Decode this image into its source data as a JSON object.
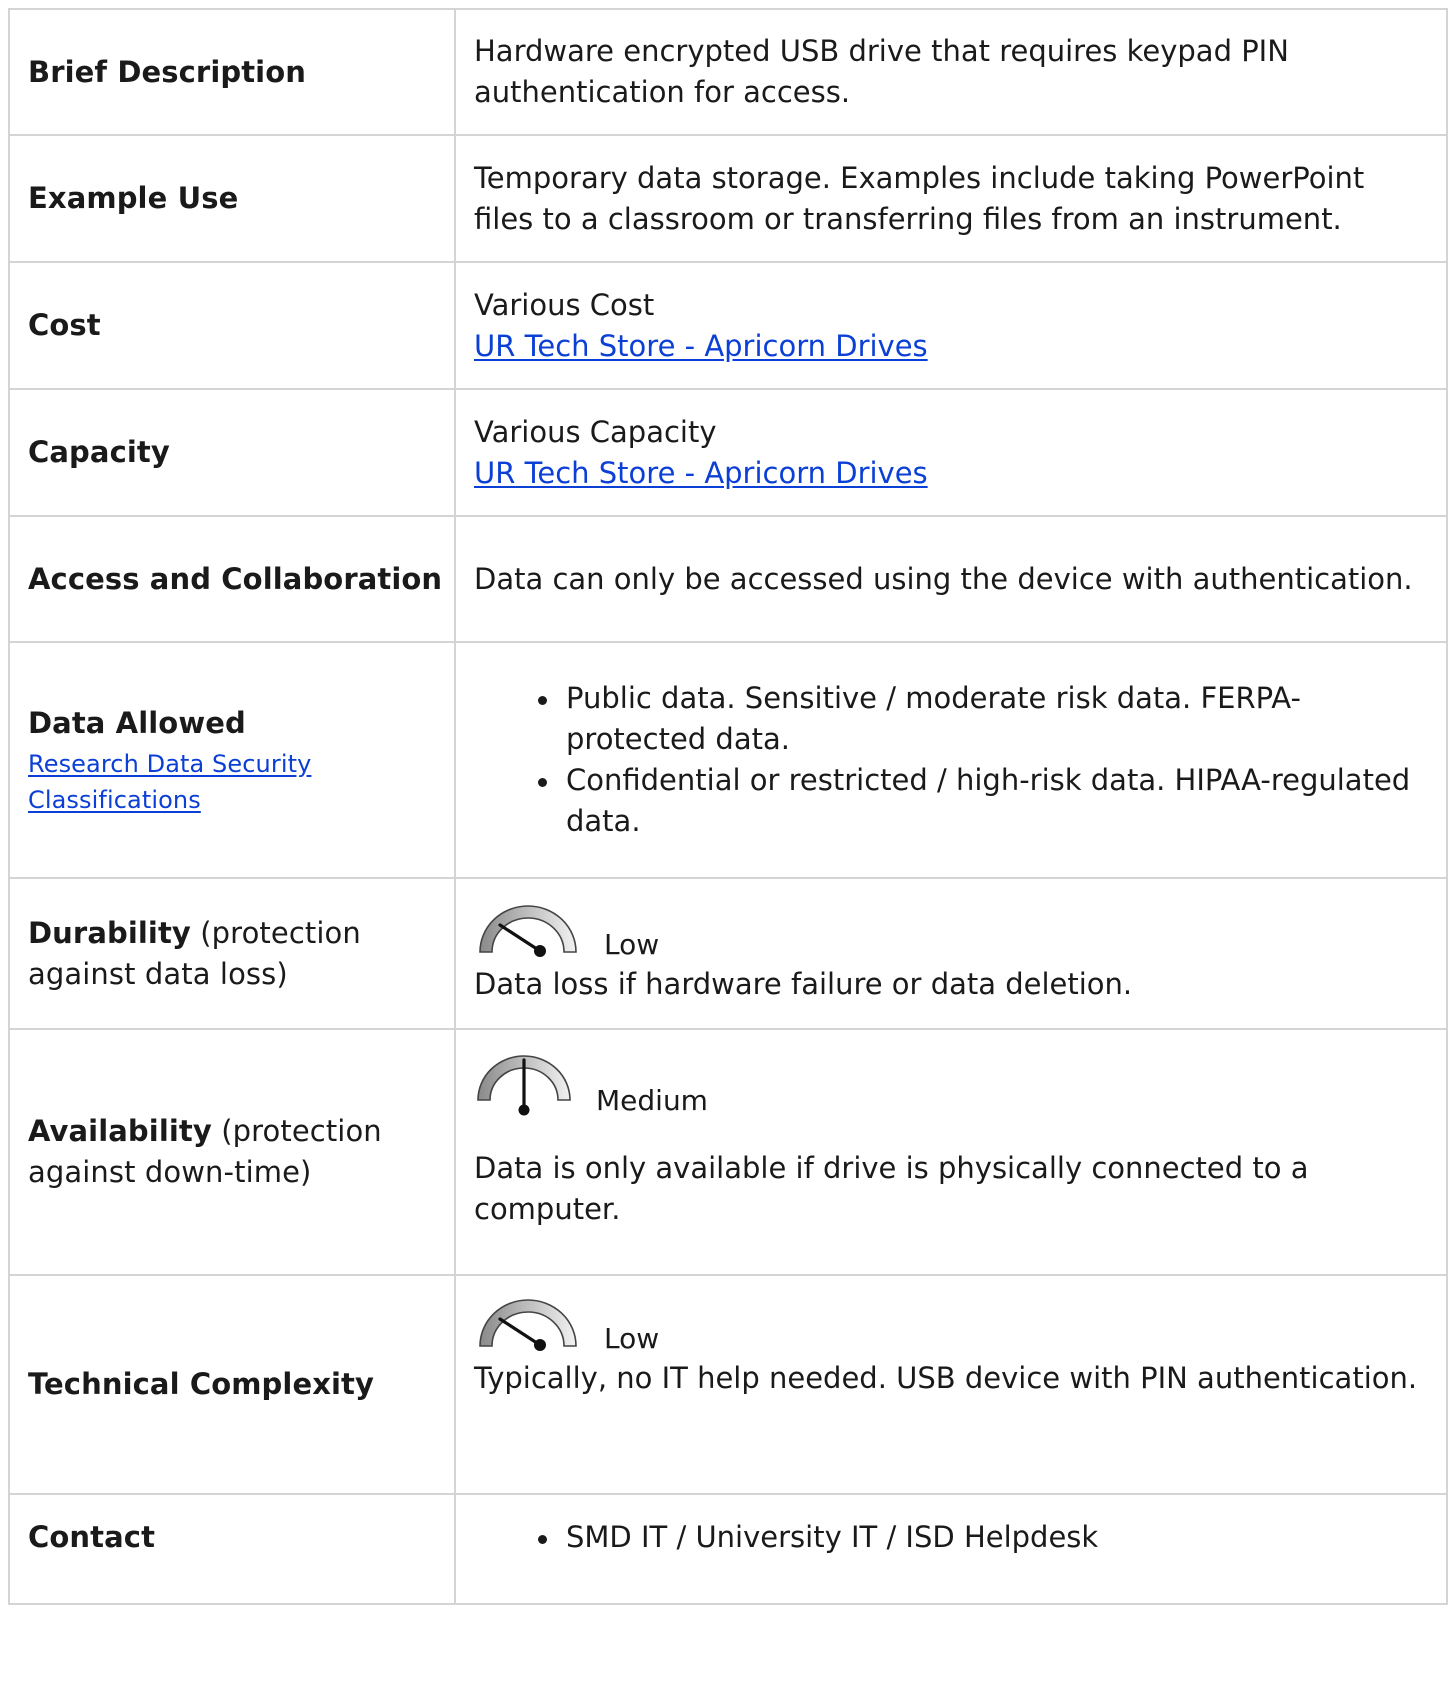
{
  "rows": {
    "brief": {
      "label": "Brief Description",
      "text": "Hardware encrypted USB drive that requires keypad PIN authentication for access."
    },
    "example": {
      "label": "Example Use",
      "text": "Temporary data storage.  Examples include taking PowerPoint files to a classroom or transferring files from an instrument."
    },
    "cost": {
      "label": "Cost",
      "text": "Various Cost",
      "link": "UR Tech Store - Apricorn Drives"
    },
    "capacity": {
      "label": "Capacity",
      "text": "Various Capacity",
      "link": "UR Tech Store - Apricorn Drives"
    },
    "access": {
      "label": "Access and Collaboration",
      "text": "Data can only be accessed using the device with authentication."
    },
    "data_allowed": {
      "label": "Data Allowed",
      "link": "Research Data Security Classifications",
      "items": [
        "Public data. Sensitive / moderate risk data. FERPA-protected data.",
        "Confidential or restricted / high-risk data. HIPAA-regulated data."
      ]
    },
    "durability": {
      "label": "Durability",
      "label_note": " (protection against data loss)",
      "level": "Low",
      "gauge_icon": "gauge-low-icon",
      "text": "Data loss if hardware failure or data deletion."
    },
    "availability": {
      "label": "Availability",
      "label_note": " (protection against down-time)",
      "level": "Medium",
      "gauge_icon": "gauge-medium-icon",
      "text": "Data is only available if drive is physically connected to a computer."
    },
    "complexity": {
      "label": "Technical Complexity",
      "level": "Low",
      "gauge_icon": "gauge-low-icon",
      "text": "Typically, no IT help needed. USB device with PIN authentication."
    },
    "contact": {
      "label": "Contact",
      "items": [
        "SMD IT / University IT / ISD Helpdesk"
      ]
    }
  },
  "colors": {
    "link": "#0b3fd6",
    "border": "#d4d4d4",
    "text": "#1a1a1a"
  }
}
